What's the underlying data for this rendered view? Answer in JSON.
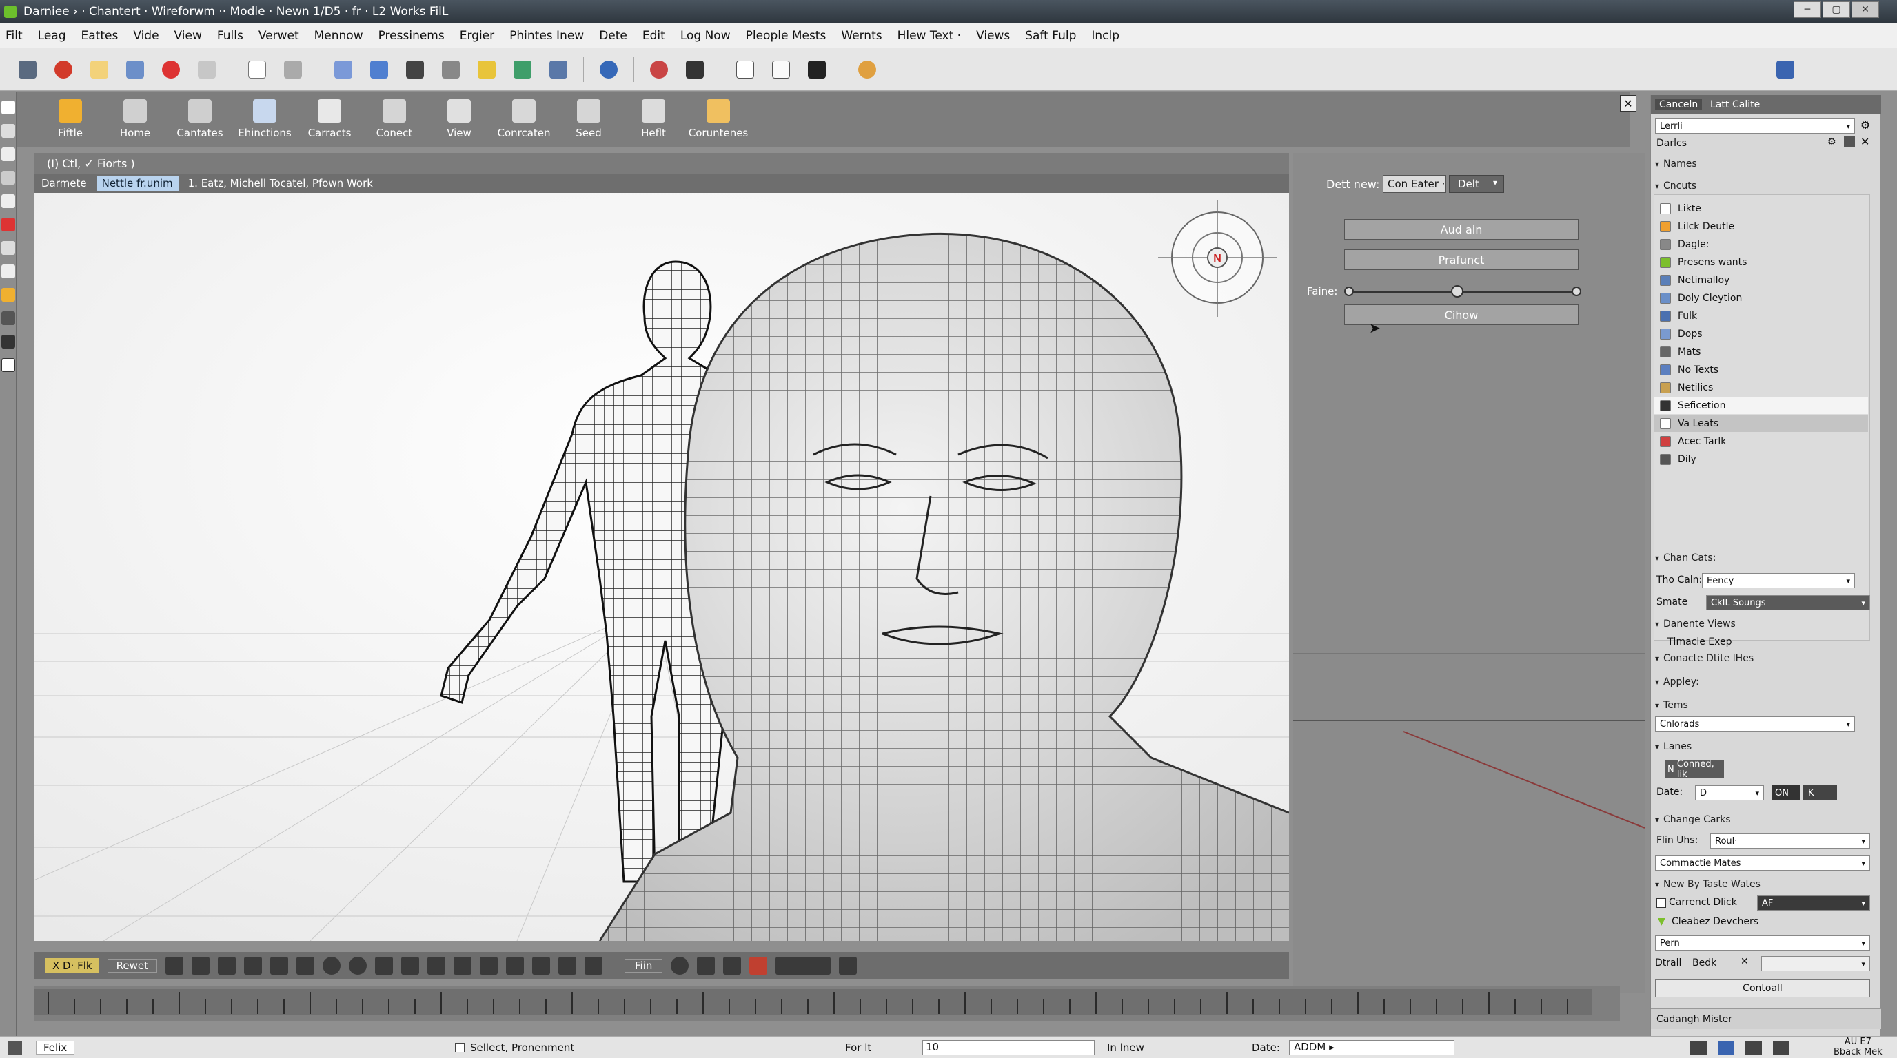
{
  "window": {
    "title": "Darniee › · Chantert · Wireforwm ·· Modle · Newn 1/D5 · fr · L2 Works  FilL"
  },
  "menu": [
    "Filt",
    "Leag",
    "Eattes",
    "Vide",
    "View",
    "Fulls",
    "Verwet",
    "Mennow",
    "Pressinems",
    "Ergier",
    "Phintes Inew",
    "Dete",
    "Edit",
    "Log Now",
    "Pleople Mests",
    "Wernts",
    "Hlew Text ·",
    "Views",
    "Saft Fulp",
    "Inclp"
  ],
  "ribbon": [
    {
      "label": "Fiftle",
      "icon": "home-icon",
      "color": "#f0b030"
    },
    {
      "label": "Home",
      "icon": "document-icon",
      "color": "#d0d0d0"
    },
    {
      "label": "Cantates",
      "icon": "people-icon",
      "color": "#cfcfcf"
    },
    {
      "label": "Ehinctions",
      "icon": "chart-icon",
      "color": "#c8d8ee"
    },
    {
      "label": "Carracts",
      "icon": "pencil-icon",
      "color": "#e8e8e8"
    },
    {
      "label": "Conect",
      "icon": "connect-icon",
      "color": "#d5d5d5"
    },
    {
      "label": "View",
      "icon": "magnifier-icon",
      "color": "#e0e0e0"
    },
    {
      "label": "Conrcaten",
      "icon": "stack-icon",
      "color": "#d8d8d8"
    },
    {
      "label": "Seed",
      "icon": "page-icon",
      "color": "#d6d6d6"
    },
    {
      "label": "Heflt",
      "icon": "sheet-icon",
      "color": "#dcdcdc"
    },
    {
      "label": "Coruntenes",
      "icon": "person-icon",
      "color": "#f0c060"
    }
  ],
  "viewport": {
    "header": "(I) Ctl,  ✓ Fiorts )",
    "tabs": [
      "Darmete",
      "Nettle fr.unim",
      "1. Eatz, Michell Tocatel,  Pfown  Work"
    ],
    "selected_tab_index": 1,
    "compass_label": "N"
  },
  "properties": {
    "dest_label": "Dett new:",
    "dest_combo1": "Con Eater ·",
    "dest_combo2": "Delt",
    "buttons": [
      "Aud ain",
      "Prafunct",
      "Cihow"
    ],
    "slider_label": "Faine:",
    "slider_value": 0.48
  },
  "dock": {
    "tabs": [
      "Canceln",
      "Latt",
      "Calite"
    ],
    "search_value": "Lerrli",
    "darks_label": "Darlcs",
    "names_header": "Names",
    "groups_header": "Cncuts",
    "items": [
      {
        "label": "Likte",
        "color": "#ffffff"
      },
      {
        "label": "Lilck Deutle",
        "color": "#f0a030"
      },
      {
        "label": "Dagle:",
        "color": "#888888"
      },
      {
        "label": "Presens wants",
        "color": "#7cbf2c"
      },
      {
        "label": "Netimalloy",
        "color": "#5a7fb8"
      },
      {
        "label": "Doly Cleytion",
        "color": "#6a8fc8"
      },
      {
        "label": "Fulk",
        "color": "#4a70b0"
      },
      {
        "label": "Dops",
        "color": "#7a9ad0"
      },
      {
        "label": "Mats",
        "color": "#666666"
      },
      {
        "label": "No Texts",
        "color": "#5b7fc0"
      },
      {
        "label": "Netilics",
        "color": "#c8a050"
      },
      {
        "label": "Seficetion",
        "color": "#333333"
      },
      {
        "label": "Va Leats",
        "color": "#ffffff"
      },
      {
        "label": "Acec Tarlk",
        "color": "#d04040"
      },
      {
        "label": "Dily",
        "color": "#555555"
      }
    ],
    "selected_item_index": 12,
    "chan_header": "Chan Cats:",
    "tm_label": "Tho Caln:",
    "tm_value": "Eency",
    "smate_label": "Smate",
    "smate_value": "CkIL Soungs",
    "davente_label": "Danente Views",
    "timacle_label": "Tlmacle Exep",
    "conacte_label": "Conacte Dtite lHes",
    "appley_header": "Appley:",
    "tems_header": "Tems",
    "tems_value": "Cnlorads",
    "lanes_header": "Lanes",
    "conned_label": "Conned, lik",
    "conned_prefix": "N",
    "date_label": "Date:",
    "date_value": "D",
    "on_value": "ON",
    "k_value": "K",
    "change_header": "Change Carks",
    "fln_label": "Flin Uhs:",
    "fln_value": "Roul·",
    "commactie_value": "Commactie Mates",
    "new_header": "New By Taste Wates",
    "carrenct_label": "Carrenct Dlick",
    "carrenct_value": "AF",
    "cleabez_label": "Cleabez Devchers",
    "pern_value": "Pern",
    "dtrall_label": "Dtrall",
    "bedk_label": "Bedk",
    "bottom_btn": "Contoall",
    "footer": "Cadangh Mister"
  },
  "bottom_toolbar": {
    "mode1": "X  D·  Flk",
    "mode2": "Rewet",
    "mode3": "Fiin"
  },
  "status": {
    "app_tab": "Felix",
    "select_label": "Sellect,  Pronenment",
    "for_label": "For lt",
    "value_field": "10",
    "in_label": "In lnew",
    "date_label": "Date:",
    "date_value": "ADDM ▸",
    "clock_line1": "AU E7",
    "clock_line2": "Bback Mek"
  }
}
